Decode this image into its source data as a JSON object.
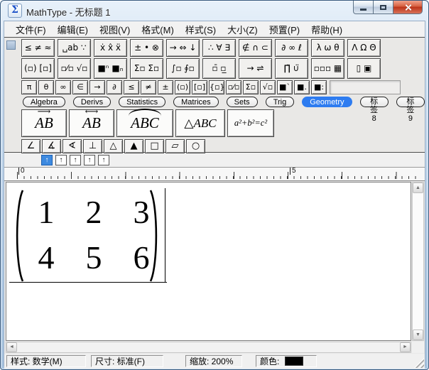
{
  "window": {
    "title": "MathType - 无标题 1",
    "icon_glyph": "Σ"
  },
  "menu": {
    "items": [
      "文件(F)",
      "编辑(E)",
      "视图(V)",
      "格式(M)",
      "样式(S)",
      "大小(Z)",
      "预置(P)",
      "帮助(H)"
    ]
  },
  "toolbar": {
    "symbol_palettes": [
      "≤ ≠ ≈",
      "␣ab ∵",
      "ẋ x̂ ẍ",
      "± • ⊗",
      "→ ⇔ ↓",
      "∴ ∀ ∃",
      "∉ ∩ ⊂",
      "∂ ∞ ℓ",
      "λ ω θ",
      "Λ Ω Θ"
    ],
    "template_palettes": [
      "(▫) [▫]",
      "▫⁄▫ √▫",
      "■ⁿ ■ₙ",
      "Σ▫ Σ▫",
      "∫▫ ∮▫",
      "▫̄ ▫̲",
      "→ ⇌",
      "∏̈ ∪̈",
      "▫▫▫ ▦",
      "▯ ▣"
    ],
    "small_bar": [
      "π",
      "θ",
      "∞",
      "∈",
      "→",
      "∂",
      "≤",
      "≠",
      "±",
      "(▫)",
      "[▫]",
      "{▫}",
      "▫⁄▫",
      "Σ▫",
      "√▫",
      "■`",
      "■.",
      "■:"
    ]
  },
  "tabs": [
    {
      "label": "Algebra"
    },
    {
      "label": "Derivs"
    },
    {
      "label": "Statistics"
    },
    {
      "label": "Matrices"
    },
    {
      "label": "Sets"
    },
    {
      "label": "Trig"
    },
    {
      "label": "Geometry",
      "active": true
    },
    {
      "label": "标签 8"
    },
    {
      "label": "标签 9"
    }
  ],
  "geometry_palette": {
    "large_buttons": [
      {
        "label": "AB",
        "cls": "vec"
      },
      {
        "label": "AB",
        "cls": "dvec"
      },
      {
        "label": "ABC",
        "cls": "arc"
      },
      {
        "label": "△ABC",
        "cls": "tri"
      },
      {
        "label": "a²+b²=c²",
        "cls": "pyth"
      }
    ],
    "small_buttons": [
      "∠",
      "∡",
      "∢",
      "⊥",
      "△",
      "▲",
      "□",
      "▱",
      "○"
    ]
  },
  "tabstops": [
    {
      "label": "↑",
      "active": true
    },
    {
      "label": "↑"
    },
    {
      "label": "↑"
    },
    {
      "label": "↑"
    },
    {
      "label": "↑"
    }
  ],
  "ruler": {
    "labels": [
      "0",
      "5"
    ]
  },
  "equation": {
    "matrix": {
      "rows": [
        [
          "1",
          "2",
          "3"
        ],
        [
          "4",
          "5",
          "6"
        ]
      ]
    }
  },
  "icons": {
    "scroll_up": "▲",
    "scroll_down": "▼",
    "scroll_left": "◄",
    "scroll_right": "►"
  },
  "statusbar": {
    "style": "样式: 数学(M)",
    "size": "尺寸: 标准(F)",
    "zoom": "缩放: 200%",
    "color_label": "颜色:",
    "color_value": "#000000"
  }
}
